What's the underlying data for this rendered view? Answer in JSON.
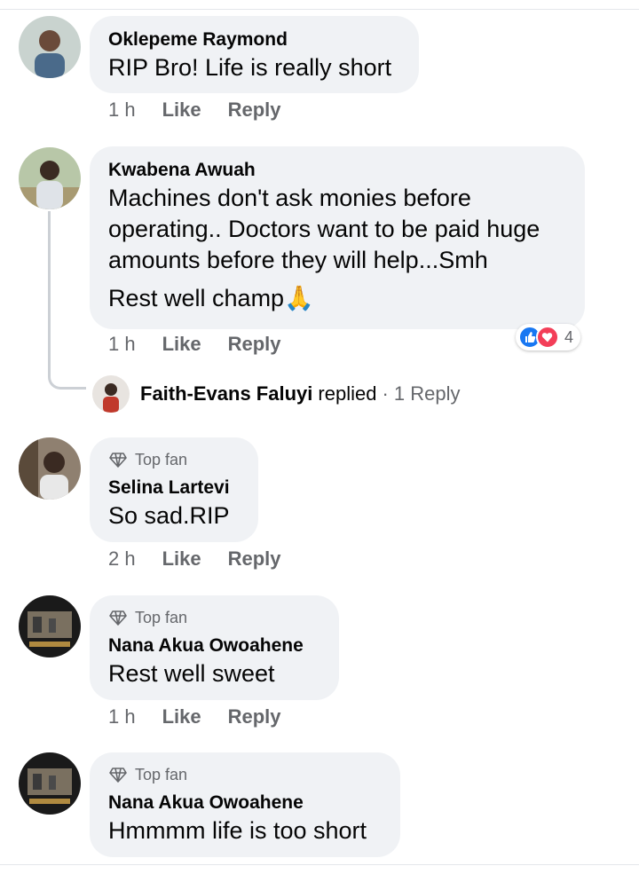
{
  "comments": [
    {
      "name": "Oklepeme Raymond",
      "lines": [
        "RIP Bro! Life is really short"
      ],
      "time": "1 h",
      "like": "Like",
      "reply": "Reply"
    },
    {
      "name": "Kwabena Awuah",
      "lines": [
        "Machines don't ask monies before",
        "operating.. Doctors want to be paid huge",
        "amounts before they will help...Smh"
      ],
      "extra": "Rest well champ",
      "emoji": "🙏",
      "time": "1 h",
      "like": "Like",
      "reply": "Reply",
      "reactions": {
        "count": "4",
        "like_color": "#1877f2",
        "love_color": "#f33e58"
      },
      "replies": {
        "name": "Faith-Evans Faluyi",
        "action": "replied",
        "count": "· 1 Reply"
      }
    },
    {
      "badge": "Top fan",
      "name": "Selina Lartevi",
      "lines": [
        "So sad.RIP"
      ],
      "time": "2 h",
      "like": "Like",
      "reply": "Reply"
    },
    {
      "badge": "Top fan",
      "name": "Nana Akua Owoahene",
      "lines": [
        "Rest well sweet"
      ],
      "time": "1 h",
      "like": "Like",
      "reply": "Reply"
    },
    {
      "badge": "Top fan",
      "name": "Nana Akua Owoahene",
      "lines": [
        "Hmmmm life is too short"
      ]
    }
  ]
}
